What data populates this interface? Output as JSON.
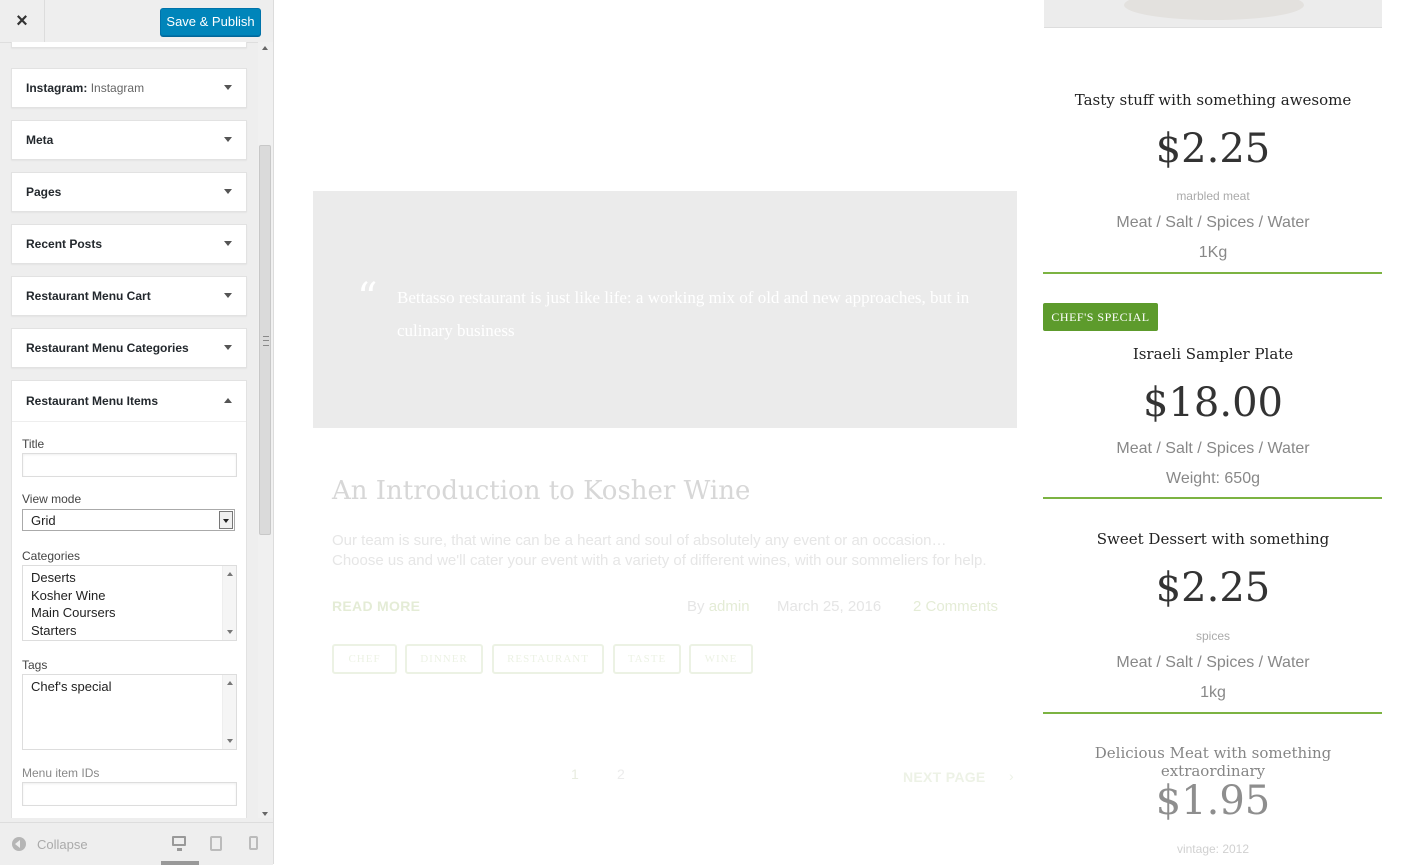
{
  "header": {
    "close_label": "×",
    "publish_label": "Save & Publish"
  },
  "widgets": [
    {
      "title": "Instagram:",
      "subtitle": "Instagram"
    },
    {
      "title": "Meta"
    },
    {
      "title": "Pages"
    },
    {
      "title": "Recent Posts"
    },
    {
      "title": "Restaurant Menu Cart"
    },
    {
      "title": "Restaurant Menu Categories"
    }
  ],
  "open_widget": {
    "title": "Restaurant Menu Items",
    "title_label": "Title",
    "title_value": "",
    "view_mode_label": "View mode",
    "view_mode_value": "Grid",
    "categories_label": "Categories",
    "categories": [
      "Deserts",
      "Kosher Wine",
      "Main Coursers",
      "Starters"
    ],
    "tags_label": "Tags",
    "tags_value": "Chef's special",
    "ids_label": "Menu item IDs",
    "ids_value": ""
  },
  "footer": {
    "collapse_label": "Collapse"
  },
  "preview": {
    "quote_mark": "“",
    "quote": "Bettasso restaurant is just like life: a working mix of old and new approaches, but in culinary business",
    "post_title": "An Introduction to Kosher Wine",
    "post_excerpt": "Our team is sure, that wine can be a heart and soul of absolutely any event or an occasion… Choose us and we'll cater your event with a variety of different wines, with our sommeliers for help.",
    "read_more": "READ MORE",
    "author_prefix": "By ",
    "author": "admin",
    "date": "March 25, 2016",
    "comments": "2 Comments",
    "tags": [
      "CHEF",
      "DINNER",
      "RESTAURANT",
      "TASTE",
      "WINE"
    ],
    "pages": [
      "1",
      "2"
    ],
    "next_page": "NEXT PAGE",
    "next_arrow": "›"
  },
  "menu_items": [
    {
      "name": "Tasty stuff with something awesome",
      "price": "$2.25",
      "desc": "marbled meat",
      "ingredients": "Meat  /  Salt  /  Spices  /  Water",
      "weight": "1Kg"
    },
    {
      "badge": "CHEF'S SPECIAL",
      "name": "Israeli Sampler Plate",
      "price": "$18.00",
      "ingredients": "Meat  /  Salt  /  Spices  /  Water",
      "weight": "Weight: 650g"
    },
    {
      "name": "Sweet Dessert with something",
      "price": "$2.25",
      "desc": "spices",
      "ingredients": "Meat  /  Salt  /  Spices  /  Water",
      "weight": "1kg"
    },
    {
      "name": "Delicious Meat with something extraordinary",
      "price": "$1.95",
      "desc": "vintage: 2012"
    }
  ],
  "colors": {
    "accent_green": "#7cb342",
    "badge_green": "#5d9b2c",
    "publish_blue": "#0085ba"
  },
  "icons": {
    "close": "close-icon",
    "collapse": "collapse-icon",
    "desktop": "desktop-icon",
    "tablet": "tablet-icon",
    "mobile": "mobile-icon",
    "quote": "quote-icon"
  }
}
